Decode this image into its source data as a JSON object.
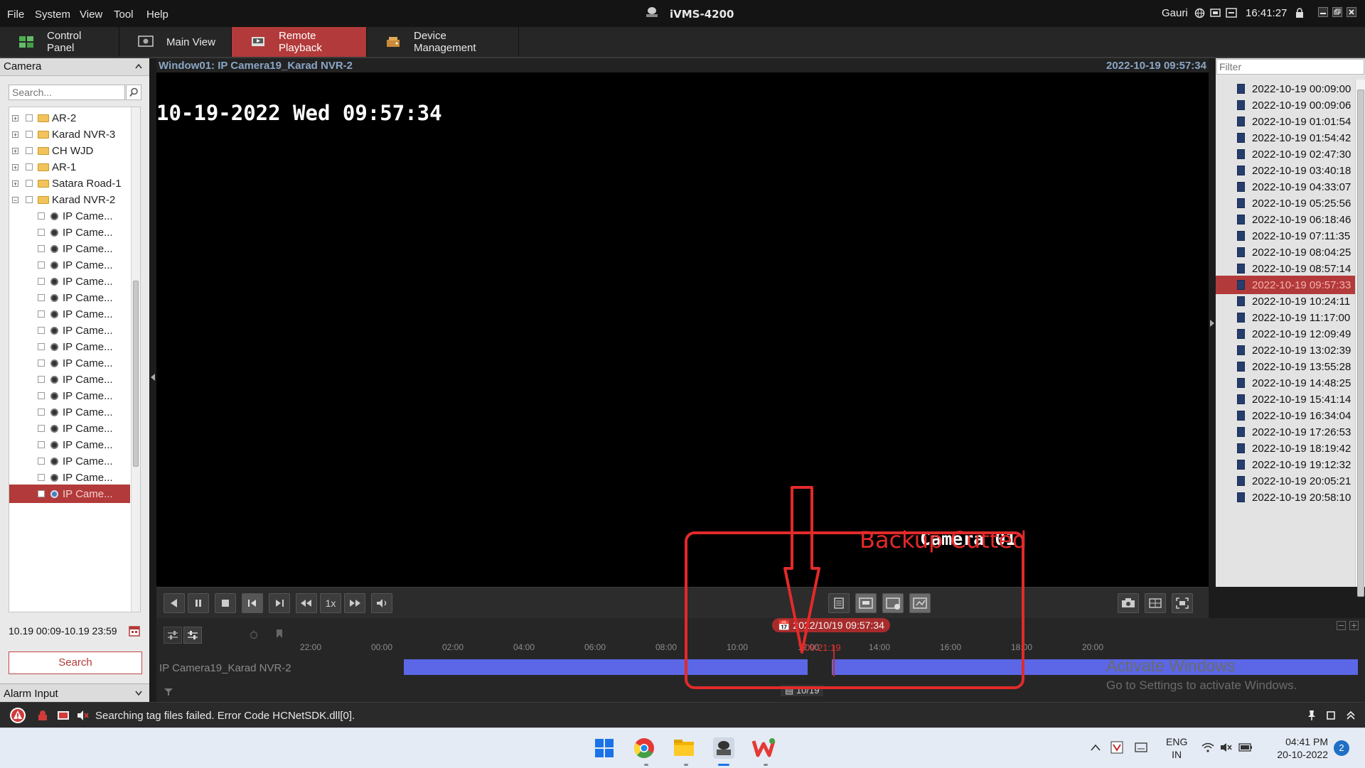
{
  "app": {
    "title": "iVMS-4200",
    "menu": [
      "File",
      "System",
      "View",
      "Tool",
      "Help"
    ],
    "user": "Gauri",
    "clock": "16:41:27"
  },
  "tabs": [
    {
      "label": "Control Panel",
      "active": false
    },
    {
      "label": "Main View",
      "active": false
    },
    {
      "label": "Remote Playback",
      "active": true
    },
    {
      "label": "Device Management",
      "active": false
    }
  ],
  "left_panel": {
    "header": "Camera",
    "search_placeholder": "Search...",
    "tree": [
      {
        "label": "AR-2",
        "type": "group",
        "expanded": false
      },
      {
        "label": "Karad NVR-3",
        "type": "group",
        "expanded": false
      },
      {
        "label": "CH WJD",
        "type": "group",
        "expanded": false
      },
      {
        "label": "AR-1",
        "type": "group",
        "expanded": false
      },
      {
        "label": "Satara Road-1",
        "type": "group",
        "expanded": false
      },
      {
        "label": "Karad NVR-2",
        "type": "group",
        "expanded": true
      }
    ],
    "camera_label": "IP Came...",
    "camera_count": 18,
    "selected_camera_index": 17,
    "date_range": "10.19 00:09-10.19 23:59",
    "search_button": "Search",
    "alarm_header": "Alarm Input"
  },
  "window": {
    "title": "Window01: IP Camera19_Karad NVR-2",
    "timestamp": "2022-10-19 09:57:34"
  },
  "video": {
    "osd_time": "10-19-2022 Wed 09:57:34",
    "osd_camera": "Camera 01"
  },
  "annotation": {
    "text": "Backup Cutted",
    "color": "#e22a2a"
  },
  "controls": {
    "speed": "1x"
  },
  "timeline": {
    "ticks": [
      "22:00",
      "00:00",
      "02:00",
      "04:00",
      "06:00",
      "08:00",
      "10:00",
      "12:00",
      "14:00",
      "16:00",
      "18:00",
      "20:00"
    ],
    "current_time": "2022/10/19 09:57:34",
    "cursor_small": "09:21:19",
    "track_label": "IP Camera19_Karad NVR-2",
    "date_chip": "10/19",
    "bar_color": "#5b67e6"
  },
  "recordings": {
    "filter_placeholder": "Filter",
    "items": [
      "2022-10-19 00:09:00",
      "2022-10-19 00:09:06",
      "2022-10-19 01:01:54",
      "2022-10-19 01:54:42",
      "2022-10-19 02:47:30",
      "2022-10-19 03:40:18",
      "2022-10-19 04:33:07",
      "2022-10-19 05:25:56",
      "2022-10-19 06:18:46",
      "2022-10-19 07:11:35",
      "2022-10-19 08:04:25",
      "2022-10-19 08:57:14",
      "2022-10-19 09:57:33",
      "2022-10-19 10:24:11",
      "2022-10-19 11:17:00",
      "2022-10-19 12:09:49",
      "2022-10-19 13:02:39",
      "2022-10-19 13:55:28",
      "2022-10-19 14:48:25",
      "2022-10-19 15:41:14",
      "2022-10-19 16:34:04",
      "2022-10-19 17:26:53",
      "2022-10-19 18:19:42",
      "2022-10-19 19:12:32",
      "2022-10-19 20:05:21",
      "2022-10-19 20:58:10"
    ],
    "selected_index": 12
  },
  "status_bar": {
    "message": "Searching tag files failed. Error Code HCNetSDK.dll[0]."
  },
  "watermark": {
    "line1": "Activate Windows",
    "line2": "Go to Settings to activate Windows."
  },
  "taskbar": {
    "lang_line1": "ENG",
    "lang_line2": "IN",
    "time": "04:41 PM",
    "date": "20-10-2022",
    "notifications": "2"
  },
  "colors": {
    "accent": "#b33a3a",
    "window_title": "#8aa5c4",
    "timeline_bar": "#5b67e6"
  }
}
